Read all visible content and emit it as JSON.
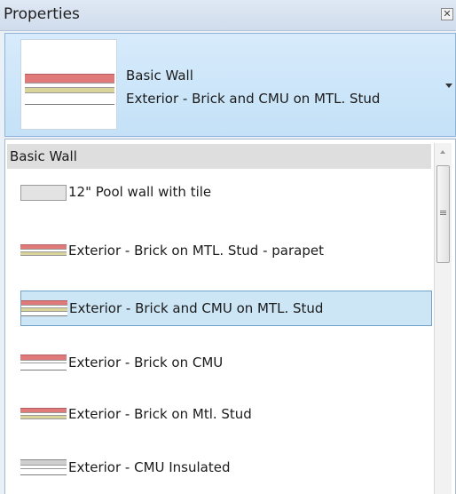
{
  "panel": {
    "title": "Properties",
    "close_glyph": "✕"
  },
  "type_selector": {
    "family": "Basic Wall",
    "type_name": "Exterior - Brick and CMU on MTL. Stud",
    "dropdown_icon": "chevron-down-icon"
  },
  "list": {
    "group_header": "Basic Wall",
    "items": [
      {
        "label": "12\" Pool wall with tile",
        "swatch": "pool-wall"
      },
      {
        "label": "Exterior - Brick  on MTL. Stud - parapet",
        "swatch": "brick-stud"
      },
      {
        "label": "Exterior - Brick and CMU on MTL. Stud",
        "swatch": "brick-cmu",
        "selected": true
      },
      {
        "label": "Exterior - Brick on CMU",
        "swatch": "brick-cmu"
      },
      {
        "label": "Exterior - Brick on Mtl. Stud",
        "swatch": "brick-stud"
      },
      {
        "label": "Exterior - CMU Insulated",
        "swatch": "cmu"
      }
    ]
  },
  "colors": {
    "selection_bg": "#cce6f6",
    "selection_border": "#6fa3cc",
    "brick": "#e07a7a",
    "insulation": "#d8d49a"
  }
}
